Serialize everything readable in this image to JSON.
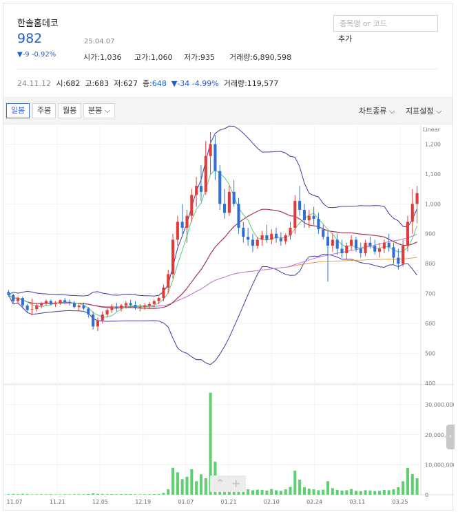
{
  "stock": {
    "name": "한솔홈데코",
    "price": "982",
    "date": "25.04.07",
    "change": "▼-9 -0.92%",
    "open_label": "시가",
    "open": "1,036",
    "high_label": "고가",
    "high": "1,060",
    "low_label": "저가",
    "low": "935",
    "volume_label": "거래량",
    "volume": "6,890,598"
  },
  "search": {
    "placeholder": "종목명 or 코드",
    "add_label": "추가"
  },
  "prev_bar": {
    "date": "24.11.12",
    "open_label": "시",
    "open": "682",
    "high_label": "고",
    "high": "683",
    "low_label": "저",
    "low": "627",
    "close_label": "종",
    "close": "648",
    "change": "▼-34 -4.99%",
    "volume_label": "거래량",
    "volume": "119,577"
  },
  "toolbar": {
    "tabs": [
      "일봉",
      "주봉",
      "월봉",
      "분봉"
    ],
    "active_tab": "일봉",
    "chart_type_label": "차트종류",
    "indicator_label": "지표설정"
  },
  "colors": {
    "up": "#e03a3a",
    "down": "#2f6fd6",
    "volume": "#5fcf72",
    "bollinger": "#3b3e9c",
    "ma_short": "#5cc87a",
    "ma_mid": "#a3334a",
    "ma_long1": "#c478e6",
    "ma_long2": "#e89a4a"
  },
  "chart_data": {
    "type": "candlestick",
    "scale_label": "Linear",
    "price_ticks": [
      400,
      500,
      600,
      700,
      800,
      900,
      "1,000",
      "1,100",
      "1,200"
    ],
    "volume_ticks": [
      "0",
      "10,000,000",
      "20,000,000",
      "30,000,000"
    ],
    "x_ticks": [
      "11.07",
      "11.21",
      "12.05",
      "12.19",
      "01.07",
      "01.21",
      "02.10",
      "02.24",
      "03.11",
      "03.25"
    ],
    "ylim": [
      400,
      1240
    ],
    "volume_ylim": [
      0,
      36000000
    ],
    "candles": [
      [
        705,
        712,
        690,
        695
      ],
      [
        695,
        700,
        670,
        675
      ],
      [
        675,
        690,
        665,
        685
      ],
      [
        685,
        690,
        650,
        660
      ],
      [
        660,
        665,
        635,
        645
      ],
      [
        648,
        683,
        627,
        648
      ],
      [
        648,
        665,
        640,
        660
      ],
      [
        660,
        672,
        650,
        668
      ],
      [
        668,
        680,
        660,
        675
      ],
      [
        675,
        680,
        660,
        665
      ],
      [
        665,
        675,
        655,
        670
      ],
      [
        670,
        680,
        662,
        678
      ],
      [
        678,
        685,
        665,
        672
      ],
      [
        672,
        680,
        660,
        668
      ],
      [
        668,
        675,
        650,
        655
      ],
      [
        655,
        665,
        640,
        660
      ],
      [
        660,
        670,
        645,
        650
      ],
      [
        650,
        655,
        620,
        630
      ],
      [
        630,
        640,
        580,
        590
      ],
      [
        590,
        620,
        575,
        610
      ],
      [
        610,
        640,
        600,
        630
      ],
      [
        630,
        650,
        620,
        645
      ],
      [
        645,
        665,
        635,
        655
      ],
      [
        655,
        670,
        640,
        650
      ],
      [
        650,
        665,
        640,
        660
      ],
      [
        660,
        675,
        650,
        668
      ],
      [
        668,
        680,
        655,
        662
      ],
      [
        662,
        675,
        645,
        652
      ],
      [
        652,
        665,
        640,
        655
      ],
      [
        655,
        668,
        645,
        660
      ],
      [
        660,
        672,
        648,
        665
      ],
      [
        665,
        680,
        655,
        675
      ],
      [
        675,
        690,
        665,
        685
      ],
      [
        685,
        730,
        675,
        720
      ],
      [
        720,
        780,
        700,
        765
      ],
      [
        765,
        900,
        750,
        880
      ],
      [
        880,
        960,
        860,
        940
      ],
      [
        940,
        1000,
        900,
        920
      ],
      [
        920,
        980,
        870,
        960
      ],
      [
        960,
        1050,
        940,
        1030
      ],
      [
        1030,
        1090,
        990,
        1060
      ],
      [
        1060,
        1130,
        1010,
        1040
      ],
      [
        1040,
        1210,
        1030,
        1160
      ],
      [
        1160,
        1240,
        1100,
        1200
      ],
      [
        1200,
        1230,
        1080,
        1110
      ],
      [
        1110,
        1130,
        980,
        1000
      ],
      [
        1000,
        1050,
        950,
        970
      ],
      [
        970,
        1060,
        960,
        1040
      ],
      [
        1040,
        1080,
        990,
        1000
      ],
      [
        1000,
        1020,
        900,
        920
      ],
      [
        920,
        940,
        870,
        890
      ],
      [
        890,
        920,
        860,
        880
      ],
      [
        880,
        900,
        840,
        860
      ],
      [
        860,
        890,
        850,
        880
      ],
      [
        880,
        910,
        860,
        895
      ],
      [
        895,
        930,
        870,
        880
      ],
      [
        880,
        915,
        865,
        900
      ],
      [
        900,
        920,
        870,
        885
      ],
      [
        885,
        905,
        860,
        875
      ],
      [
        875,
        900,
        865,
        895
      ],
      [
        895,
        940,
        880,
        920
      ],
      [
        920,
        1030,
        900,
        1010
      ],
      [
        1010,
        1060,
        960,
        980
      ],
      [
        980,
        1000,
        920,
        945
      ],
      [
        945,
        980,
        920,
        960
      ],
      [
        960,
        990,
        930,
        950
      ],
      [
        950,
        970,
        900,
        915
      ],
      [
        915,
        930,
        880,
        890
      ],
      [
        890,
        910,
        740,
        860
      ],
      [
        860,
        900,
        840,
        880
      ],
      [
        880,
        900,
        830,
        850
      ],
      [
        850,
        880,
        820,
        835
      ],
      [
        835,
        870,
        815,
        860
      ],
      [
        860,
        895,
        845,
        880
      ],
      [
        880,
        890,
        840,
        850
      ],
      [
        850,
        870,
        820,
        835
      ],
      [
        835,
        880,
        825,
        870
      ],
      [
        870,
        890,
        850,
        860
      ],
      [
        860,
        880,
        830,
        840
      ],
      [
        840,
        870,
        820,
        850
      ],
      [
        850,
        880,
        835,
        870
      ],
      [
        870,
        900,
        840,
        855
      ],
      [
        855,
        870,
        800,
        820
      ],
      [
        820,
        850,
        780,
        800
      ],
      [
        800,
        880,
        790,
        860
      ],
      [
        860,
        960,
        840,
        940
      ],
      [
        940,
        1050,
        900,
        1000
      ],
      [
        1000,
        1060,
        935,
        1036
      ]
    ],
    "volumes": [
      200000,
      250000,
      180000,
      300000,
      220000,
      119577,
      150000,
      170000,
      160000,
      180000,
      140000,
      150000,
      170000,
      160000,
      180000,
      200000,
      190000,
      260000,
      450000,
      300000,
      250000,
      200000,
      220000,
      180000,
      190000,
      200000,
      210000,
      170000,
      160000,
      180000,
      190000,
      210000,
      250000,
      600000,
      1800000,
      9000000,
      7500000,
      5200000,
      6000000,
      8500000,
      4500000,
      6800000,
      5500000,
      34000000,
      11000000,
      4500000,
      5800000,
      4200000,
      3500000,
      2500000,
      2000000,
      1800000,
      1500000,
      1700000,
      1600000,
      1400000,
      1900000,
      1500000,
      1300000,
      1800000,
      2600000,
      8000000,
      5000000,
      2500000,
      2000000,
      1800000,
      1500000,
      1700000,
      4500000,
      2200000,
      1600000,
      1400000,
      1500000,
      1900000,
      1300000,
      1200000,
      1500000,
      1400000,
      1200000,
      1300000,
      1600000,
      1500000,
      1800000,
      2500000,
      4500000,
      9000000,
      6890598,
      5500000
    ]
  }
}
